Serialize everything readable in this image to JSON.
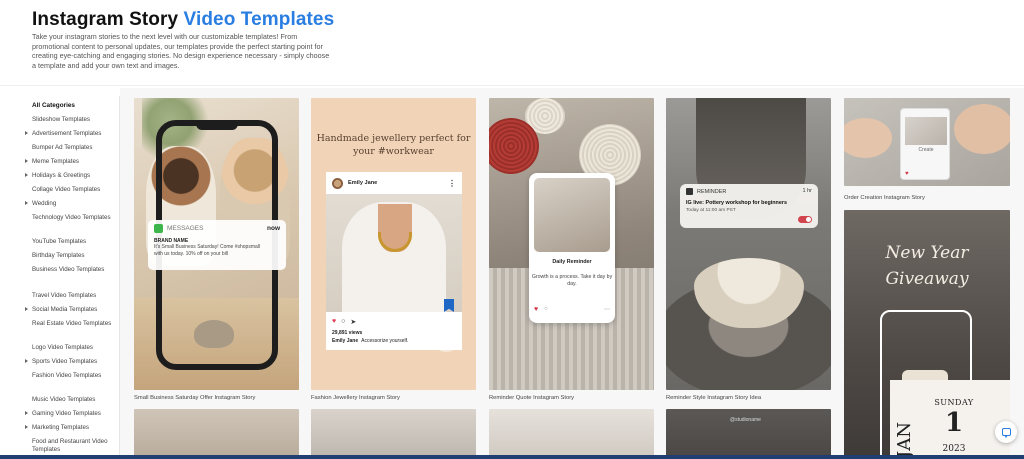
{
  "header": {
    "title_main": "Instagram Story ",
    "title_accent": "Video Templates",
    "description": "Take your instagram stories to the next level with our customizable templates! From promotional content to personal updates, our templates provide the perfect starting point for creating eye-catching and engaging stories. No design experience necessary - simply choose a template and add your own text and images."
  },
  "sidebar": {
    "items": [
      {
        "label": "All Categories",
        "active": true,
        "arrow": false
      },
      {
        "label": "Slideshow Templates",
        "arrow": false
      },
      {
        "label": "Advertisement Templates",
        "arrow": true
      },
      {
        "label": "Bumper Ad Templates",
        "arrow": false
      },
      {
        "label": "Meme Templates",
        "arrow": true
      },
      {
        "label": "Holidays & Greetings",
        "arrow": true
      },
      {
        "label": "Collage Video Templates",
        "arrow": false
      },
      {
        "label": "Wedding",
        "arrow": true
      },
      {
        "label": "Technology Video Templates",
        "arrow": false
      },
      {
        "label": "YouTube Templates",
        "arrow": false
      },
      {
        "label": "Birthday Templates",
        "arrow": false
      },
      {
        "label": "Business Video Templates",
        "arrow": false
      },
      {
        "label": "Travel Video Templates",
        "arrow": false
      },
      {
        "label": "Social Media Templates",
        "arrow": true
      },
      {
        "label": "Real Estate Video Templates",
        "arrow": false
      },
      {
        "label": "Logo Video Templates",
        "arrow": false
      },
      {
        "label": "Sports Video Templates",
        "arrow": true
      },
      {
        "label": "Fashion Video Templates",
        "arrow": false
      },
      {
        "label": "Music Video Templates",
        "arrow": false
      },
      {
        "label": "Gaming Video Templates",
        "arrow": true
      },
      {
        "label": "Marketing Templates",
        "arrow": true
      },
      {
        "label": "Food and Restaurant Video Templates",
        "arrow": false
      }
    ]
  },
  "templates": {
    "t1": {
      "caption": "Small Business Saturday Offer Instagram Story",
      "msg_app": "MESSAGES",
      "msg_time": "now",
      "msg_brand": "BRAND NAME",
      "msg_body": "It's Small Business Saturday! Come #shopsmall with us today. 10% off on your bill"
    },
    "t2": {
      "caption": "Fashion Jewellery Instagram Story",
      "heading": "Handmade jewellery perfect for your #workwear",
      "user": "Emily Jane",
      "views": "29,891 views",
      "cap_user": "Emily Jane",
      "cap_text": "Accessorize yourself."
    },
    "t3": {
      "caption": "Reminder Quote Instagram Story",
      "card_title": "Daily Reminder",
      "quote": "Growth is a process. Take it day by day."
    },
    "t4": {
      "caption": "Reminder Style Instagram Story Idea",
      "app": "REMINDER",
      "time": "1 hr",
      "line1": "IG live: Pottery workshop for beginners",
      "line2": "Today at 11:00 am PST"
    },
    "t5": {
      "caption": "Order Creation Instagram Story",
      "card_text": "Create"
    },
    "t6": {
      "title_line1": "New Year",
      "title_line2": "Giveaway",
      "month": "JAN",
      "weekday": "SUNDAY",
      "day": "1",
      "year": "2023"
    },
    "b4": {
      "tag": "@studioname"
    }
  },
  "colors": {
    "accent": "#2a7de1",
    "footer_bar": "#1f3f73"
  }
}
